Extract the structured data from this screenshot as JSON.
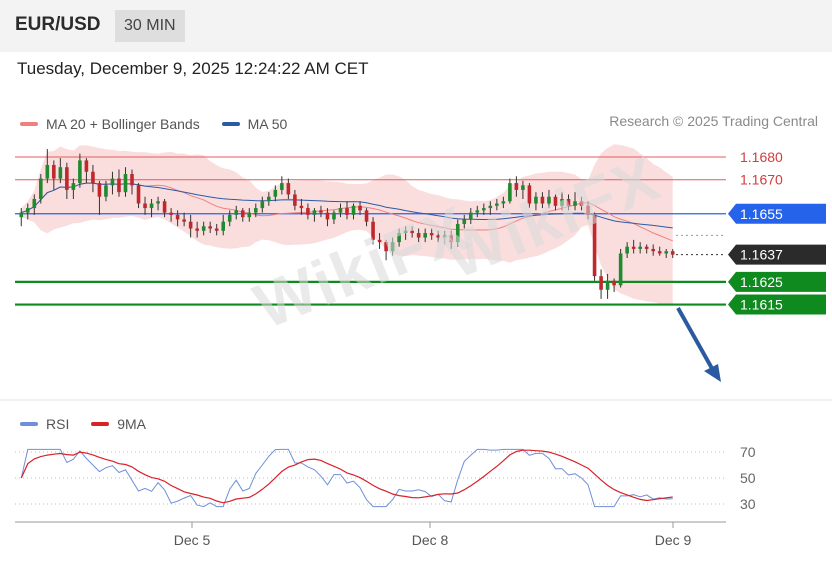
{
  "header": {
    "symbol": "EUR/USD",
    "timeframe": "30 MIN"
  },
  "datetime": "Tuesday, December 9, 2025 12:24:22 AM CET",
  "legend": {
    "items": [
      {
        "label": "MA 20 + Bollinger Bands",
        "color": "#f08080"
      },
      {
        "label": "MA 50",
        "color": "#2a5ba8"
      }
    ],
    "credit": "Research © 2025 Trading Central"
  },
  "rsi_legend": {
    "items": [
      {
        "label": "RSI",
        "color": "#6f8fd8"
      },
      {
        "label": "9MA",
        "color": "#d8222a"
      }
    ]
  },
  "watermark": "WikiFX",
  "chart_data": {
    "type": "candlestick",
    "x_labels": [
      "Dec 5",
      "Dec 8",
      "Dec 9"
    ],
    "levels": [
      {
        "value": "1.1680",
        "kind": "resistance",
        "color": "#e25c5c"
      },
      {
        "value": "1.1670",
        "kind": "resistance",
        "color": "#e25c5c"
      },
      {
        "value": "1.1655",
        "kind": "pivot",
        "color": "#2563eb"
      },
      {
        "value": "1.1637",
        "kind": "last",
        "color": "#333333"
      },
      {
        "value": "1.1625",
        "kind": "support",
        "color": "#0f8a1f"
      },
      {
        "value": "1.1615",
        "kind": "support",
        "color": "#0f8a1f"
      }
    ],
    "price_range": [
      1.161,
      1.1685
    ],
    "rsi_ticks": [
      "70",
      "50",
      "30"
    ],
    "rsi_range": [
      20,
      80
    ],
    "forecast": "down toward 1.1615",
    "ohlc": [
      [
        1.16535,
        1.16575,
        1.16495,
        1.16555
      ],
      [
        1.16555,
        1.16595,
        1.16525,
        1.16575
      ],
      [
        1.16575,
        1.16635,
        1.16545,
        1.16615
      ],
      [
        1.16615,
        1.16725,
        1.16595,
        1.16705
      ],
      [
        1.16705,
        1.16835,
        1.16685,
        1.16765
      ],
      [
        1.16765,
        1.16785,
        1.16655,
        1.16705
      ],
      [
        1.16705,
        1.16795,
        1.16685,
        1.16755
      ],
      [
        1.16755,
        1.16775,
        1.16615,
        1.16655
      ],
      [
        1.16655,
        1.16705,
        1.16615,
        1.16685
      ],
      [
        1.16685,
        1.16815,
        1.16665,
        1.16785
      ],
      [
        1.16785,
        1.16795,
        1.16685,
        1.16735
      ],
      [
        1.16735,
        1.16765,
        1.16645,
        1.16685
      ],
      [
        1.16685,
        1.16695,
        1.16545,
        1.16625
      ],
      [
        1.16625,
        1.16695,
        1.16605,
        1.16675
      ],
      [
        1.16675,
        1.16735,
        1.16635,
        1.16705
      ],
      [
        1.16705,
        1.16745,
        1.16625,
        1.16645
      ],
      [
        1.16645,
        1.16755,
        1.16625,
        1.16725
      ],
      [
        1.16725,
        1.16745,
        1.16635,
        1.16675
      ],
      [
        1.16675,
        1.16685,
        1.16575,
        1.16595
      ],
      [
        1.16595,
        1.16625,
        1.16545,
        1.16575
      ],
      [
        1.16575,
        1.16615,
        1.16535,
        1.16595
      ],
      [
        1.16595,
        1.16625,
        1.16565,
        1.16605
      ],
      [
        1.16605,
        1.16615,
        1.16535,
        1.16555
      ],
      [
        1.16555,
        1.16575,
        1.16515,
        1.16545
      ],
      [
        1.16545,
        1.16565,
        1.16495,
        1.16525
      ],
      [
        1.16525,
        1.16555,
        1.16495,
        1.16515
      ],
      [
        1.16515,
        1.16545,
        1.16445,
        1.16485
      ],
      [
        1.16485,
        1.16515,
        1.16445,
        1.16475
      ],
      [
        1.16475,
        1.16515,
        1.16455,
        1.16495
      ],
      [
        1.16495,
        1.16515,
        1.16465,
        1.16485
      ],
      [
        1.16485,
        1.16505,
        1.16455,
        1.16475
      ],
      [
        1.16475,
        1.16545,
        1.16455,
        1.16515
      ],
      [
        1.16515,
        1.16565,
        1.16495,
        1.16545
      ],
      [
        1.16545,
        1.16585,
        1.16525,
        1.16565
      ],
      [
        1.16565,
        1.16575,
        1.16515,
        1.16535
      ],
      [
        1.16535,
        1.16575,
        1.16515,
        1.16555
      ],
      [
        1.16555,
        1.16595,
        1.16535,
        1.16575
      ],
      [
        1.16575,
        1.16625,
        1.16555,
        1.16605
      ],
      [
        1.16605,
        1.16645,
        1.16585,
        1.16625
      ],
      [
        1.16625,
        1.16675,
        1.16605,
        1.16655
      ],
      [
        1.16655,
        1.16715,
        1.16635,
        1.16685
      ],
      [
        1.16685,
        1.16705,
        1.16615,
        1.16635
      ],
      [
        1.16635,
        1.16655,
        1.16565,
        1.16585
      ],
      [
        1.16585,
        1.16615,
        1.16545,
        1.16575
      ],
      [
        1.16575,
        1.16595,
        1.16525,
        1.16545
      ],
      [
        1.16545,
        1.16575,
        1.16515,
        1.16565
      ],
      [
        1.16565,
        1.16585,
        1.16535,
        1.16555
      ],
      [
        1.16555,
        1.16575,
        1.16495,
        1.16525
      ],
      [
        1.16525,
        1.16565,
        1.16505,
        1.16555
      ],
      [
        1.16555,
        1.16595,
        1.16535,
        1.16575
      ],
      [
        1.16575,
        1.16605,
        1.16525,
        1.16545
      ],
      [
        1.16545,
        1.16595,
        1.16525,
        1.16585
      ],
      [
        1.16585,
        1.16605,
        1.16545,
        1.16565
      ],
      [
        1.16565,
        1.16575,
        1.16495,
        1.16515
      ],
      [
        1.16515,
        1.16535,
        1.16415,
        1.16435
      ],
      [
        1.16435,
        1.16465,
        1.16395,
        1.16425
      ],
      [
        1.16425,
        1.16435,
        1.16345,
        1.16385
      ],
      [
        1.16385,
        1.16445,
        1.16365,
        1.16425
      ],
      [
        1.16425,
        1.16485,
        1.16405,
        1.16465
      ],
      [
        1.16465,
        1.16495,
        1.16435,
        1.16475
      ],
      [
        1.16475,
        1.16495,
        1.16445,
        1.16465
      ],
      [
        1.16465,
        1.16485,
        1.16425,
        1.16445
      ],
      [
        1.16445,
        1.16485,
        1.16425,
        1.16465
      ],
      [
        1.16465,
        1.16485,
        1.16435,
        1.16455
      ],
      [
        1.16455,
        1.16475,
        1.16425,
        1.16445
      ],
      [
        1.16445,
        1.16475,
        1.16415,
        1.16455
      ],
      [
        1.16455,
        1.16475,
        1.16395,
        1.16425
      ],
      [
        1.16425,
        1.16525,
        1.16405,
        1.16505
      ],
      [
        1.16505,
        1.16545,
        1.16485,
        1.16525
      ],
      [
        1.16525,
        1.16575,
        1.16505,
        1.16555
      ],
      [
        1.16555,
        1.16585,
        1.16535,
        1.16565
      ],
      [
        1.16565,
        1.16595,
        1.16545,
        1.16575
      ],
      [
        1.16575,
        1.16605,
        1.16545,
        1.16585
      ],
      [
        1.16585,
        1.16615,
        1.16565,
        1.16595
      ],
      [
        1.16595,
        1.16625,
        1.16575,
        1.16605
      ],
      [
        1.16605,
        1.16705,
        1.16595,
        1.16685
      ],
      [
        1.16685,
        1.16715,
        1.16625,
        1.16655
      ],
      [
        1.16655,
        1.16695,
        1.16615,
        1.16675
      ],
      [
        1.16675,
        1.16685,
        1.16575,
        1.16595
      ],
      [
        1.16595,
        1.16645,
        1.16565,
        1.16625
      ],
      [
        1.16625,
        1.16645,
        1.16575,
        1.16595
      ],
      [
        1.16595,
        1.16655,
        1.16575,
        1.16625
      ],
      [
        1.16625,
        1.16635,
        1.16565,
        1.16585
      ],
      [
        1.16585,
        1.16645,
        1.16565,
        1.16615
      ],
      [
        1.16615,
        1.16635,
        1.16565,
        1.16585
      ],
      [
        1.16585,
        1.16645,
        1.16565,
        1.16605
      ],
      [
        1.16605,
        1.16625,
        1.16565,
        1.16585
      ],
      [
        1.16585,
        1.16605,
        1.16525,
        1.16545
      ],
      [
        1.16545,
        1.16555,
        1.16255,
        1.16275
      ],
      [
        1.16275,
        1.16305,
        1.16175,
        1.16215
      ],
      [
        1.16215,
        1.16285,
        1.16175,
        1.16255
      ],
      [
        1.16255,
        1.16265,
        1.16205,
        1.16235
      ],
      [
        1.16235,
        1.16395,
        1.16225,
        1.16375
      ],
      [
        1.16375,
        1.16425,
        1.16355,
        1.16405
      ],
      [
        1.16405,
        1.16435,
        1.16375,
        1.16395
      ],
      [
        1.16395,
        1.16425,
        1.16375,
        1.16405
      ],
      [
        1.16405,
        1.16415,
        1.16375,
        1.16395
      ],
      [
        1.16395,
        1.16415,
        1.16365,
        1.16385
      ],
      [
        1.16385,
        1.16405,
        1.16365,
        1.16375
      ],
      [
        1.16375,
        1.16395,
        1.16355,
        1.16385
      ],
      [
        1.16385,
        1.16395,
        1.16355,
        1.1637
      ]
    ]
  }
}
